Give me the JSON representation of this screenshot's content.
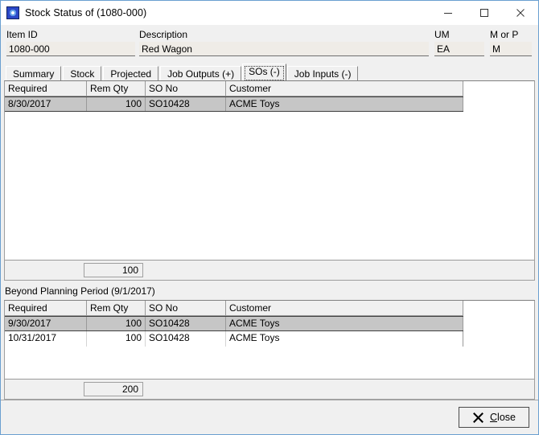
{
  "window": {
    "title": "Stock Status of (1080-000)",
    "icon": "app-icon",
    "controls": {
      "minimize": "minimize-icon",
      "maximize": "maximize-icon",
      "close": "close-icon"
    }
  },
  "header_fields": [
    {
      "label": "Item ID",
      "value": "1080-000"
    },
    {
      "label": "Description",
      "value": "Red Wagon"
    },
    {
      "label": "UM",
      "value": "EA"
    },
    {
      "label": "M or P",
      "value": "M"
    }
  ],
  "tabs": [
    {
      "label": "Summary",
      "selected": false
    },
    {
      "label": "Stock",
      "selected": false
    },
    {
      "label": "Projected",
      "selected": false
    },
    {
      "label": "Job Outputs (+)",
      "selected": false
    },
    {
      "label": "SOs (-)",
      "selected": true
    },
    {
      "label": "Job Inputs (-)",
      "selected": false
    }
  ],
  "upper_grid": {
    "columns": [
      "Required",
      "Rem Qty",
      "SO No",
      "Customer"
    ],
    "rows": [
      {
        "required": "8/30/2017",
        "rem_qty": "100",
        "so_no": "SO10428",
        "customer": "ACME Toys",
        "selected": true
      }
    ],
    "total": "100"
  },
  "beyond_planning_period": {
    "label": "Beyond Planning Period (9/1/2017)"
  },
  "lower_grid": {
    "columns": [
      "Required",
      "Rem Qty",
      "SO No",
      "Customer"
    ],
    "rows": [
      {
        "required": "9/30/2017",
        "rem_qty": "100",
        "so_no": "SO10428",
        "customer": "ACME Toys",
        "selected": true
      },
      {
        "required": "10/31/2017",
        "rem_qty": "100",
        "so_no": "SO10428",
        "customer": "ACME Toys",
        "selected": false
      }
    ],
    "total": "200"
  },
  "footer": {
    "close_button": {
      "accel": "C",
      "rest": "lose",
      "icon": "x-icon"
    }
  },
  "colors": {
    "window_border": "#6a9fd0",
    "face": "#f0f0f0",
    "field_bg": "#efece7",
    "selection": "#c6c6c6",
    "grid_line": "#9a9a9a"
  }
}
